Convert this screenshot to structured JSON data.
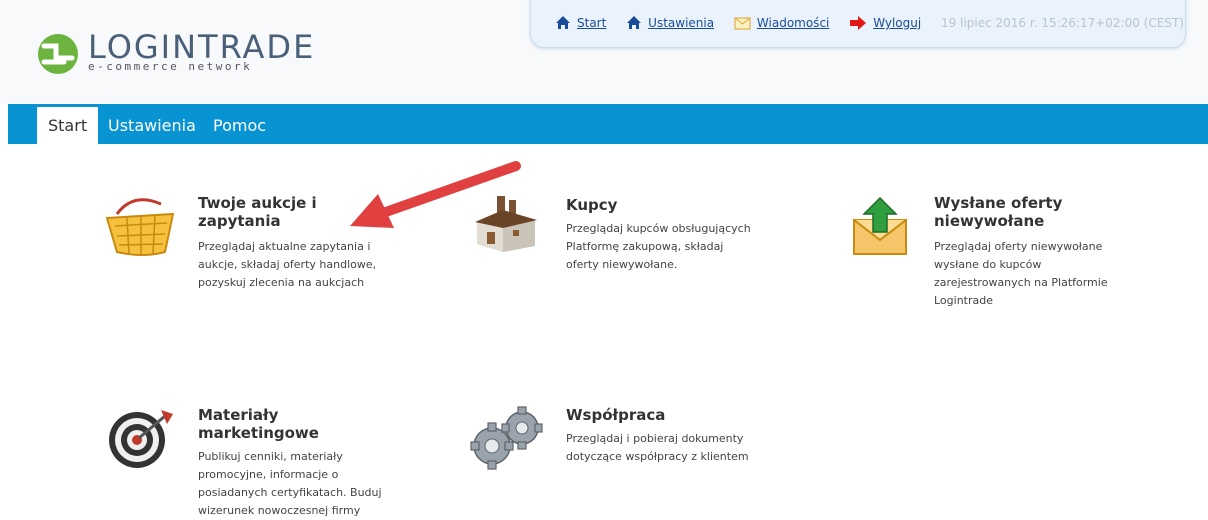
{
  "logo": {
    "name": "LOGINTRADE",
    "tagline": "e-commerce network"
  },
  "toplinks": {
    "items": [
      {
        "label": "Start",
        "icon": "home-icon"
      },
      {
        "label": "Ustawienia",
        "icon": "home-icon"
      },
      {
        "label": "Wiadomości",
        "icon": "envelope-icon"
      },
      {
        "label": "Wyloguj",
        "icon": "logout-arrow-icon"
      }
    ],
    "timestamp": "19 lipiec 2016 r. 15:26:17+02:00 (CEST)"
  },
  "nav": {
    "tabs": [
      {
        "label": "Start",
        "active": true
      },
      {
        "label": "Ustawienia"
      },
      {
        "label": "Pomoc"
      }
    ]
  },
  "tiles": [
    {
      "title": "Twoje aukcje i zapytania",
      "title_lines": [
        "Twoje aukcje i",
        "zapytania"
      ],
      "desc_lines": [
        "Przeglądaj aktualne zapytania i",
        "aukcje, składaj oferty handlowe,",
        "pozyskuj zlecenia na aukcjach"
      ],
      "icon": "shopping-basket-icon"
    },
    {
      "title": "Kupcy",
      "title_lines": [
        "Kupcy"
      ],
      "desc_lines": [
        "Przeglądaj kupców obsługujących",
        "Platformę zakupową, składaj",
        "oferty niewywołane."
      ],
      "icon": "factory-icon"
    },
    {
      "title": "Wysłane oferty niewywołane",
      "title_lines": [
        "Wysłane oferty",
        "niewywołane"
      ],
      "desc_lines": [
        "Przeglądaj oferty niewywołane",
        "wysłane do kupców",
        "zarejestrowanych na Platformie",
        "Logintrade"
      ],
      "icon": "envelope-upload-icon"
    },
    {
      "title": "Materiały marketingowe",
      "title_lines": [
        "Materiały",
        "marketingowe"
      ],
      "desc_lines": [
        "Publikuj cenniki, materiały",
        "promocyjne, informacje o",
        "posiadanych certyfikatach. Buduj",
        "wizerunek nowoczesnej firmy"
      ],
      "icon": "target-icon"
    },
    {
      "title": "Współpraca",
      "title_lines": [
        "Współpraca"
      ],
      "desc_lines": [
        "Przeglądaj i pobieraj dokumenty",
        "dotyczące współpracy z klientem"
      ],
      "icon": "gears-icon"
    }
  ],
  "colors": {
    "nav_bg": "#0893d3",
    "link": "#1a4c9c",
    "annotation_arrow": "#e04040",
    "logo_green": "#6db33f"
  }
}
